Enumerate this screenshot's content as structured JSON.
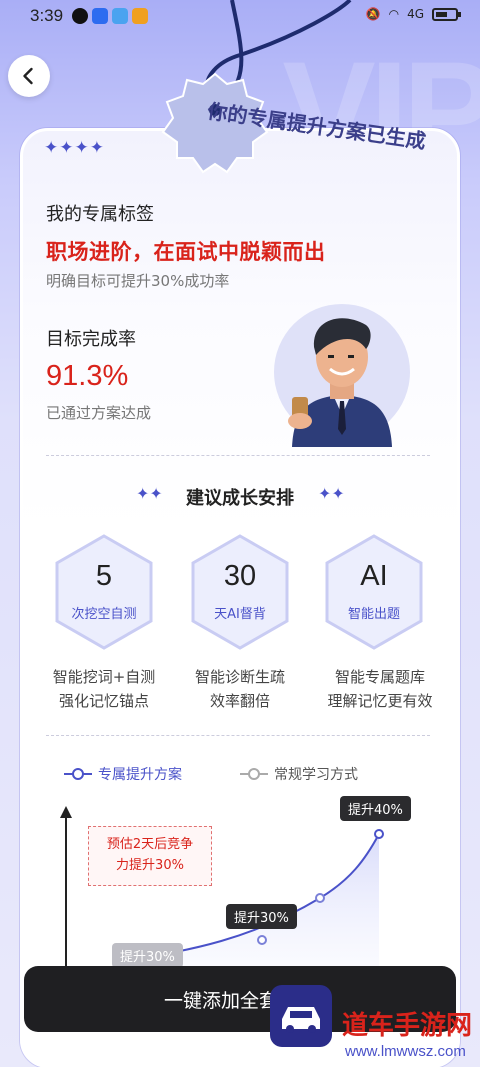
{
  "status_bar": {
    "time": "3:39",
    "network": "4G",
    "battery_level": 0.6
  },
  "header": {
    "back_icon": "chevron-left-icon"
  },
  "banner": {
    "text": "你的专属提升方案已生成",
    "stars": "✦✦✦✦"
  },
  "profile": {
    "tag_label": "我的专属标签",
    "headline": "职场进阶，在面试中脱颖而出",
    "headline_sub": "明确目标可提升30%成功率",
    "rate_label": "目标完成率",
    "rate_value": "91.3%",
    "rate_sub": "已通过方案达成"
  },
  "plan": {
    "title": "建议成长安排",
    "items": [
      {
        "value": "5",
        "caption": "次挖空自测",
        "desc1": "智能挖词+自测",
        "desc2": "强化记忆锚点"
      },
      {
        "value": "30",
        "caption": "天AI督背",
        "desc1": "智能诊断生疏",
        "desc2": "效率翻倍"
      },
      {
        "value": "AI",
        "caption": "智能出题",
        "desc1": "智能专属题库",
        "desc2": "理解记忆更有效"
      }
    ]
  },
  "chart": {
    "legend_custom": "专属提升方案",
    "legend_normal": "常规学习方式",
    "tip_high": "提升40%",
    "tip_mid": "提升30%",
    "tip_low": "提升30%",
    "note": "预估2天后竞争力提升30%",
    "note_line1": "预估2天后竞争",
    "note_line2": "力提升30%"
  },
  "cta": {
    "label": "一键添加全套方案"
  },
  "watermark": {
    "text": "道车手游网",
    "url": "www.lmwwsz.com"
  },
  "colors": {
    "accent": "#4a52c9",
    "red": "#d9231b",
    "dark": "#1f1f22"
  }
}
